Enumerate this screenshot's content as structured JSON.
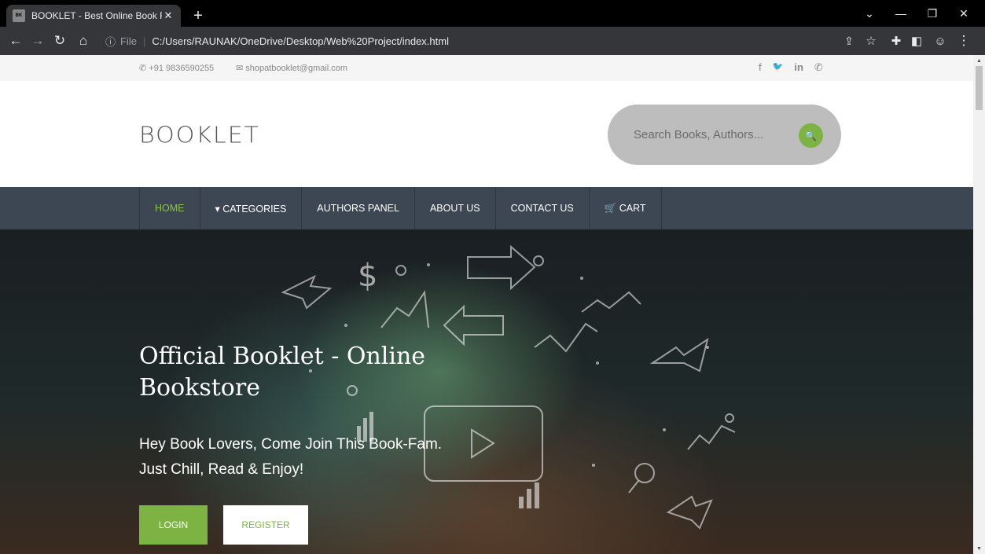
{
  "browser": {
    "tab_title": "BOOKLET - Best Online Book Rea",
    "favicon_text": "BOOKLET",
    "url_prefix": "File",
    "url": "C:/Users/RAUNAK/OneDrive/Desktop/Web%20Project/index.html"
  },
  "topinfo": {
    "phone": "+91 9836590255",
    "email": "shopatbooklet@gmail.com",
    "social": [
      "f",
      "🐦",
      "in",
      "✆"
    ]
  },
  "brand": {
    "logo": "BOOKLET",
    "search_placeholder": "Search Books, Authors..."
  },
  "nav": {
    "items": [
      {
        "label": "HOME"
      },
      {
        "label": "▾ CATEGORIES"
      },
      {
        "label": "AUTHORS PANEL"
      },
      {
        "label": "ABOUT US"
      },
      {
        "label": "CONTACT US"
      },
      {
        "label": "🛒 CART"
      }
    ]
  },
  "hero": {
    "title": "Official Booklet - Online Bookstore",
    "subtitle_line1": "Hey Book Lovers, Come Join This Book-Fam.",
    "subtitle_line2": "Just Chill, Read & Enjoy!",
    "login_label": "LOGIN",
    "register_label": "REGISTER"
  },
  "colors": {
    "accent": "#7cb342",
    "nav_bg": "#3d4653"
  }
}
